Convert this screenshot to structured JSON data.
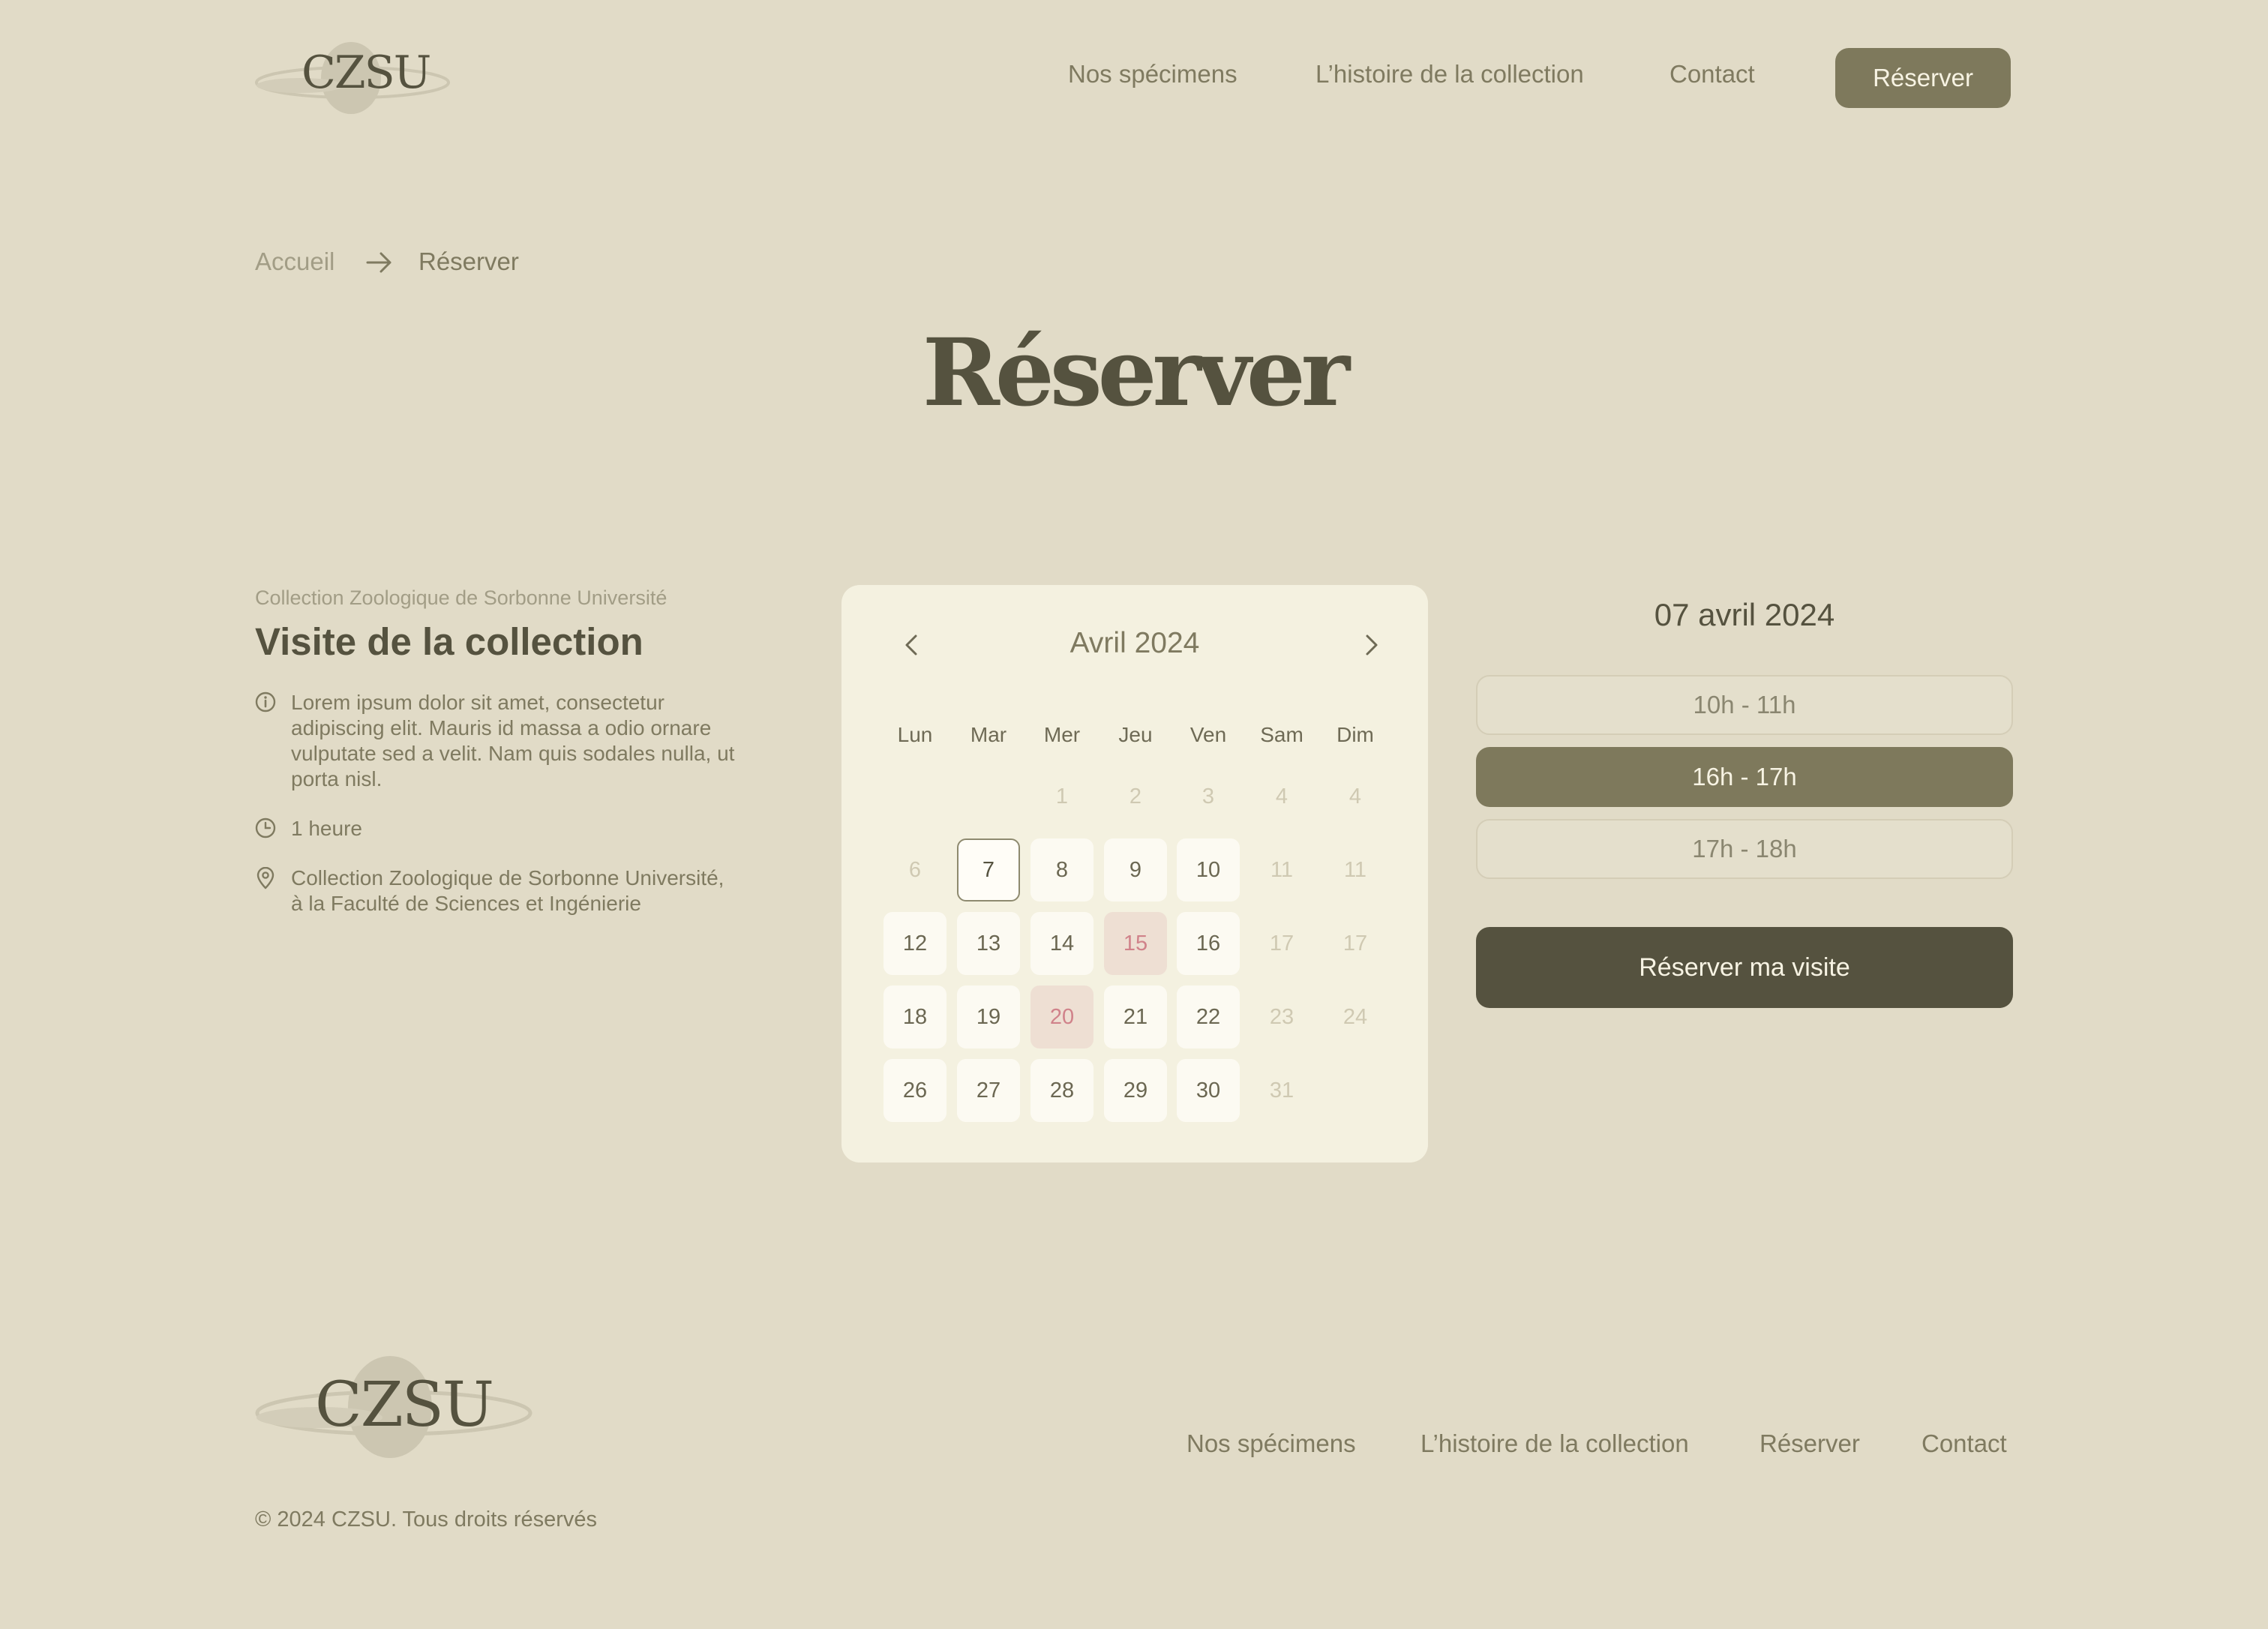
{
  "header": {
    "logo_text": "CZSU",
    "nav": [
      "Nos spécimens",
      "L’histoire de la collection",
      "Contact"
    ],
    "cta_label": "Réserver"
  },
  "breadcrumb": {
    "home": "Accueil",
    "current": "Réserver"
  },
  "page_title": "Réserver",
  "visit": {
    "org": "Collection Zoologique de Sorbonne Université",
    "title": "Visite de la collection",
    "description_lines": [
      "Lorem ipsum dolor sit amet, consectetur",
      "adipiscing elit. Mauris id massa a odio ornare",
      "vulputate sed a velit. Nam quis sodales nulla, ut",
      "porta nisl."
    ],
    "duration": "1 heure",
    "location_lines": [
      "Collection Zoologique de Sorbonne Université,",
      "à la Faculté de Sciences et Ingénierie"
    ]
  },
  "calendar": {
    "month_label": "Avril 2024",
    "weekdays": [
      "Lun",
      "Mar",
      "Mer",
      "Jeu",
      "Ven",
      "Sam",
      "Dim"
    ],
    "weeks": [
      [
        null,
        null,
        {
          "d": "1",
          "s": "inactive"
        },
        {
          "d": "2",
          "s": "inactive"
        },
        {
          "d": "3",
          "s": "inactive"
        },
        {
          "d": "4",
          "s": "inactive"
        },
        {
          "d": "4",
          "s": "inactive"
        }
      ],
      [
        {
          "d": "6",
          "s": "inactive"
        },
        {
          "d": "7",
          "s": "selected"
        },
        {
          "d": "8",
          "s": "active"
        },
        {
          "d": "9",
          "s": "active"
        },
        {
          "d": "10",
          "s": "active"
        },
        {
          "d": "11",
          "s": "inactive"
        },
        {
          "d": "11",
          "s": "inactive"
        }
      ],
      [
        {
          "d": "12",
          "s": "active"
        },
        {
          "d": "13",
          "s": "active"
        },
        {
          "d": "14",
          "s": "active"
        },
        {
          "d": "15",
          "s": "booked"
        },
        {
          "d": "16",
          "s": "active"
        },
        {
          "d": "17",
          "s": "inactive"
        },
        {
          "d": "17",
          "s": "inactive"
        }
      ],
      [
        {
          "d": "18",
          "s": "active"
        },
        {
          "d": "19",
          "s": "active"
        },
        {
          "d": "20",
          "s": "booked"
        },
        {
          "d": "21",
          "s": "active"
        },
        {
          "d": "22",
          "s": "active"
        },
        {
          "d": "23",
          "s": "inactive"
        },
        {
          "d": "24",
          "s": "inactive"
        }
      ],
      [
        {
          "d": "26",
          "s": "active"
        },
        {
          "d": "27",
          "s": "active"
        },
        {
          "d": "28",
          "s": "active"
        },
        {
          "d": "29",
          "s": "active"
        },
        {
          "d": "30",
          "s": "active"
        },
        {
          "d": "31",
          "s": "inactive"
        },
        null
      ]
    ]
  },
  "booking": {
    "selected_date": "07 avril 2024",
    "slots": [
      {
        "label": "10h - 11h",
        "selected": false
      },
      {
        "label": "16h - 17h",
        "selected": true
      },
      {
        "label": "17h - 18h",
        "selected": false
      }
    ],
    "submit_label": "Réserver ma visite"
  },
  "footer": {
    "logo_text": "CZSU",
    "links": [
      "Nos spécimens",
      "L’histoire de la collection",
      "Réserver",
      "Contact"
    ],
    "copyright": "© 2024 CZSU. Tous droits réservés"
  },
  "colors": {
    "background": "#E1DBC7",
    "accent": "#7E795C",
    "dark": "#55523F",
    "booked_day_bg": "#EEDFD3",
    "booked_day_text": "#D0828A"
  }
}
